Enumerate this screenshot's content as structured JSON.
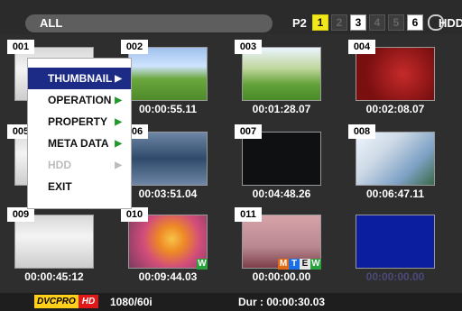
{
  "header": {
    "mode_label": "ALL",
    "slot_prefix": "P2",
    "slots": [
      "1",
      "2",
      "3",
      "4",
      "5",
      "6"
    ],
    "hdd_label": "HDD"
  },
  "menu": {
    "items": [
      {
        "label": "THUMBNAIL",
        "arrow": "▶"
      },
      {
        "label": "OPERATION",
        "arrow": "▶"
      },
      {
        "label": "PROPERTY",
        "arrow": "▶"
      },
      {
        "label": "META DATA",
        "arrow": "▶"
      },
      {
        "label": "HDD",
        "arrow": "▶"
      },
      {
        "label": "EXIT"
      }
    ]
  },
  "clips": [
    {
      "no": "001",
      "timecode": "",
      "art": "cam"
    },
    {
      "no": "002",
      "timecode": "00:00:55.11",
      "art": "tree"
    },
    {
      "no": "003",
      "timecode": "00:01:28.07",
      "art": "grass"
    },
    {
      "no": "004",
      "timecode": "00:02:08.07",
      "art": "neo"
    },
    {
      "no": "005",
      "timecode": "",
      "art": "cam"
    },
    {
      "no": "006",
      "timecode": "00:03:51.04",
      "art": "water"
    },
    {
      "no": "007",
      "timecode": "00:04:48.26",
      "art": "dark"
    },
    {
      "no": "008",
      "timecode": "00:06:47.11",
      "art": "house"
    },
    {
      "no": "009",
      "timecode": "00:00:45:12",
      "art": "cam"
    },
    {
      "no": "010",
      "timecode": "00:09:44.03",
      "art": "flowers",
      "badges": [
        "W"
      ]
    },
    {
      "no": "011",
      "timecode": "00:00:00.00",
      "art": "lips",
      "badges": [
        "M",
        "T",
        "E",
        "W"
      ]
    },
    {
      "no": "",
      "timecode": "00:00:00.00",
      "art": "blue"
    }
  ],
  "footer": {
    "codec_dv": "DVCPRO",
    "codec_hd": "HD",
    "format": "1080/60i",
    "duration": "Dur : 00:00:30.03"
  },
  "colors": {
    "selected_menu": "#1c2c86",
    "active_slot": "#f2e61c",
    "menu_arrow": "#1f9a2c"
  }
}
